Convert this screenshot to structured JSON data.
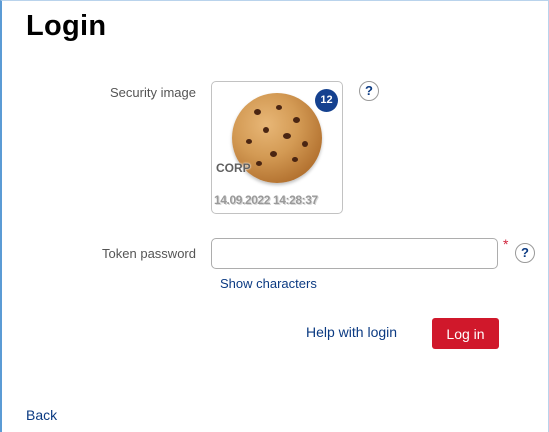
{
  "page": {
    "title": "Login"
  },
  "security_image": {
    "label": "Security image",
    "badge": "12",
    "overlay_text": "CORP",
    "timestamp": "14.09.2022 14:28:37"
  },
  "token_password": {
    "label": "Token password",
    "value": "",
    "placeholder": "",
    "required_marker": "*",
    "show_characters_label": "Show characters"
  },
  "help": {
    "icon_glyph": "?"
  },
  "actions": {
    "help_with_login_label": "Help with login",
    "login_button_label": "Log in"
  },
  "footer": {
    "back_label": "Back"
  },
  "colors": {
    "accent_blue": "#0b3a82",
    "button_red": "#d0182b",
    "badge_blue": "#15418f",
    "required_red": "#d0243c",
    "frame_blue": "#5b9bd5"
  },
  "icons": {
    "help": "help-icon",
    "cookie": "cookie-image"
  }
}
